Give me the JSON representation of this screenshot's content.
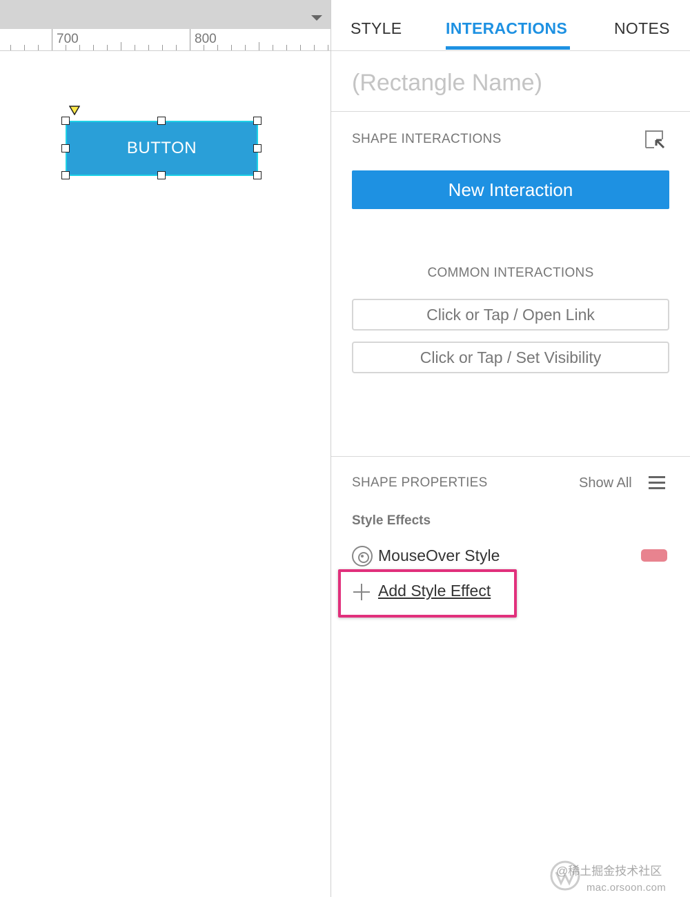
{
  "canvas": {
    "ruler_labels": [
      "700",
      "800"
    ],
    "shape": {
      "label": "BUTTON",
      "fill_color": "#2a9fd8",
      "border_color": "#1ed1e6"
    }
  },
  "tabs": [
    {
      "label": "STYLE",
      "active": false
    },
    {
      "label": "INTERACTIONS",
      "active": true
    },
    {
      "label": "NOTES",
      "active": false
    }
  ],
  "name_field": {
    "placeholder": "(Rectangle Name)",
    "value": ""
  },
  "shape_interactions": {
    "title": "SHAPE INTERACTIONS",
    "new_interaction_label": "New Interaction",
    "common_title": "COMMON INTERACTIONS",
    "common_items": [
      "Click or Tap / Open Link",
      "Click or Tap / Set Visibility"
    ]
  },
  "shape_properties": {
    "title": "SHAPE PROPERTIES",
    "show_all_label": "Show All",
    "style_effects_title": "Style Effects",
    "effects": [
      {
        "label": "MouseOver Style",
        "swatch_color": "#e8838f"
      }
    ],
    "add_effect_label": "Add Style Effect"
  },
  "colors": {
    "accent": "#1e91e2",
    "highlight": "#e1307c"
  },
  "watermark": {
    "text": "@稀土掘金技术社区",
    "url": "mac.orsoon.com"
  }
}
